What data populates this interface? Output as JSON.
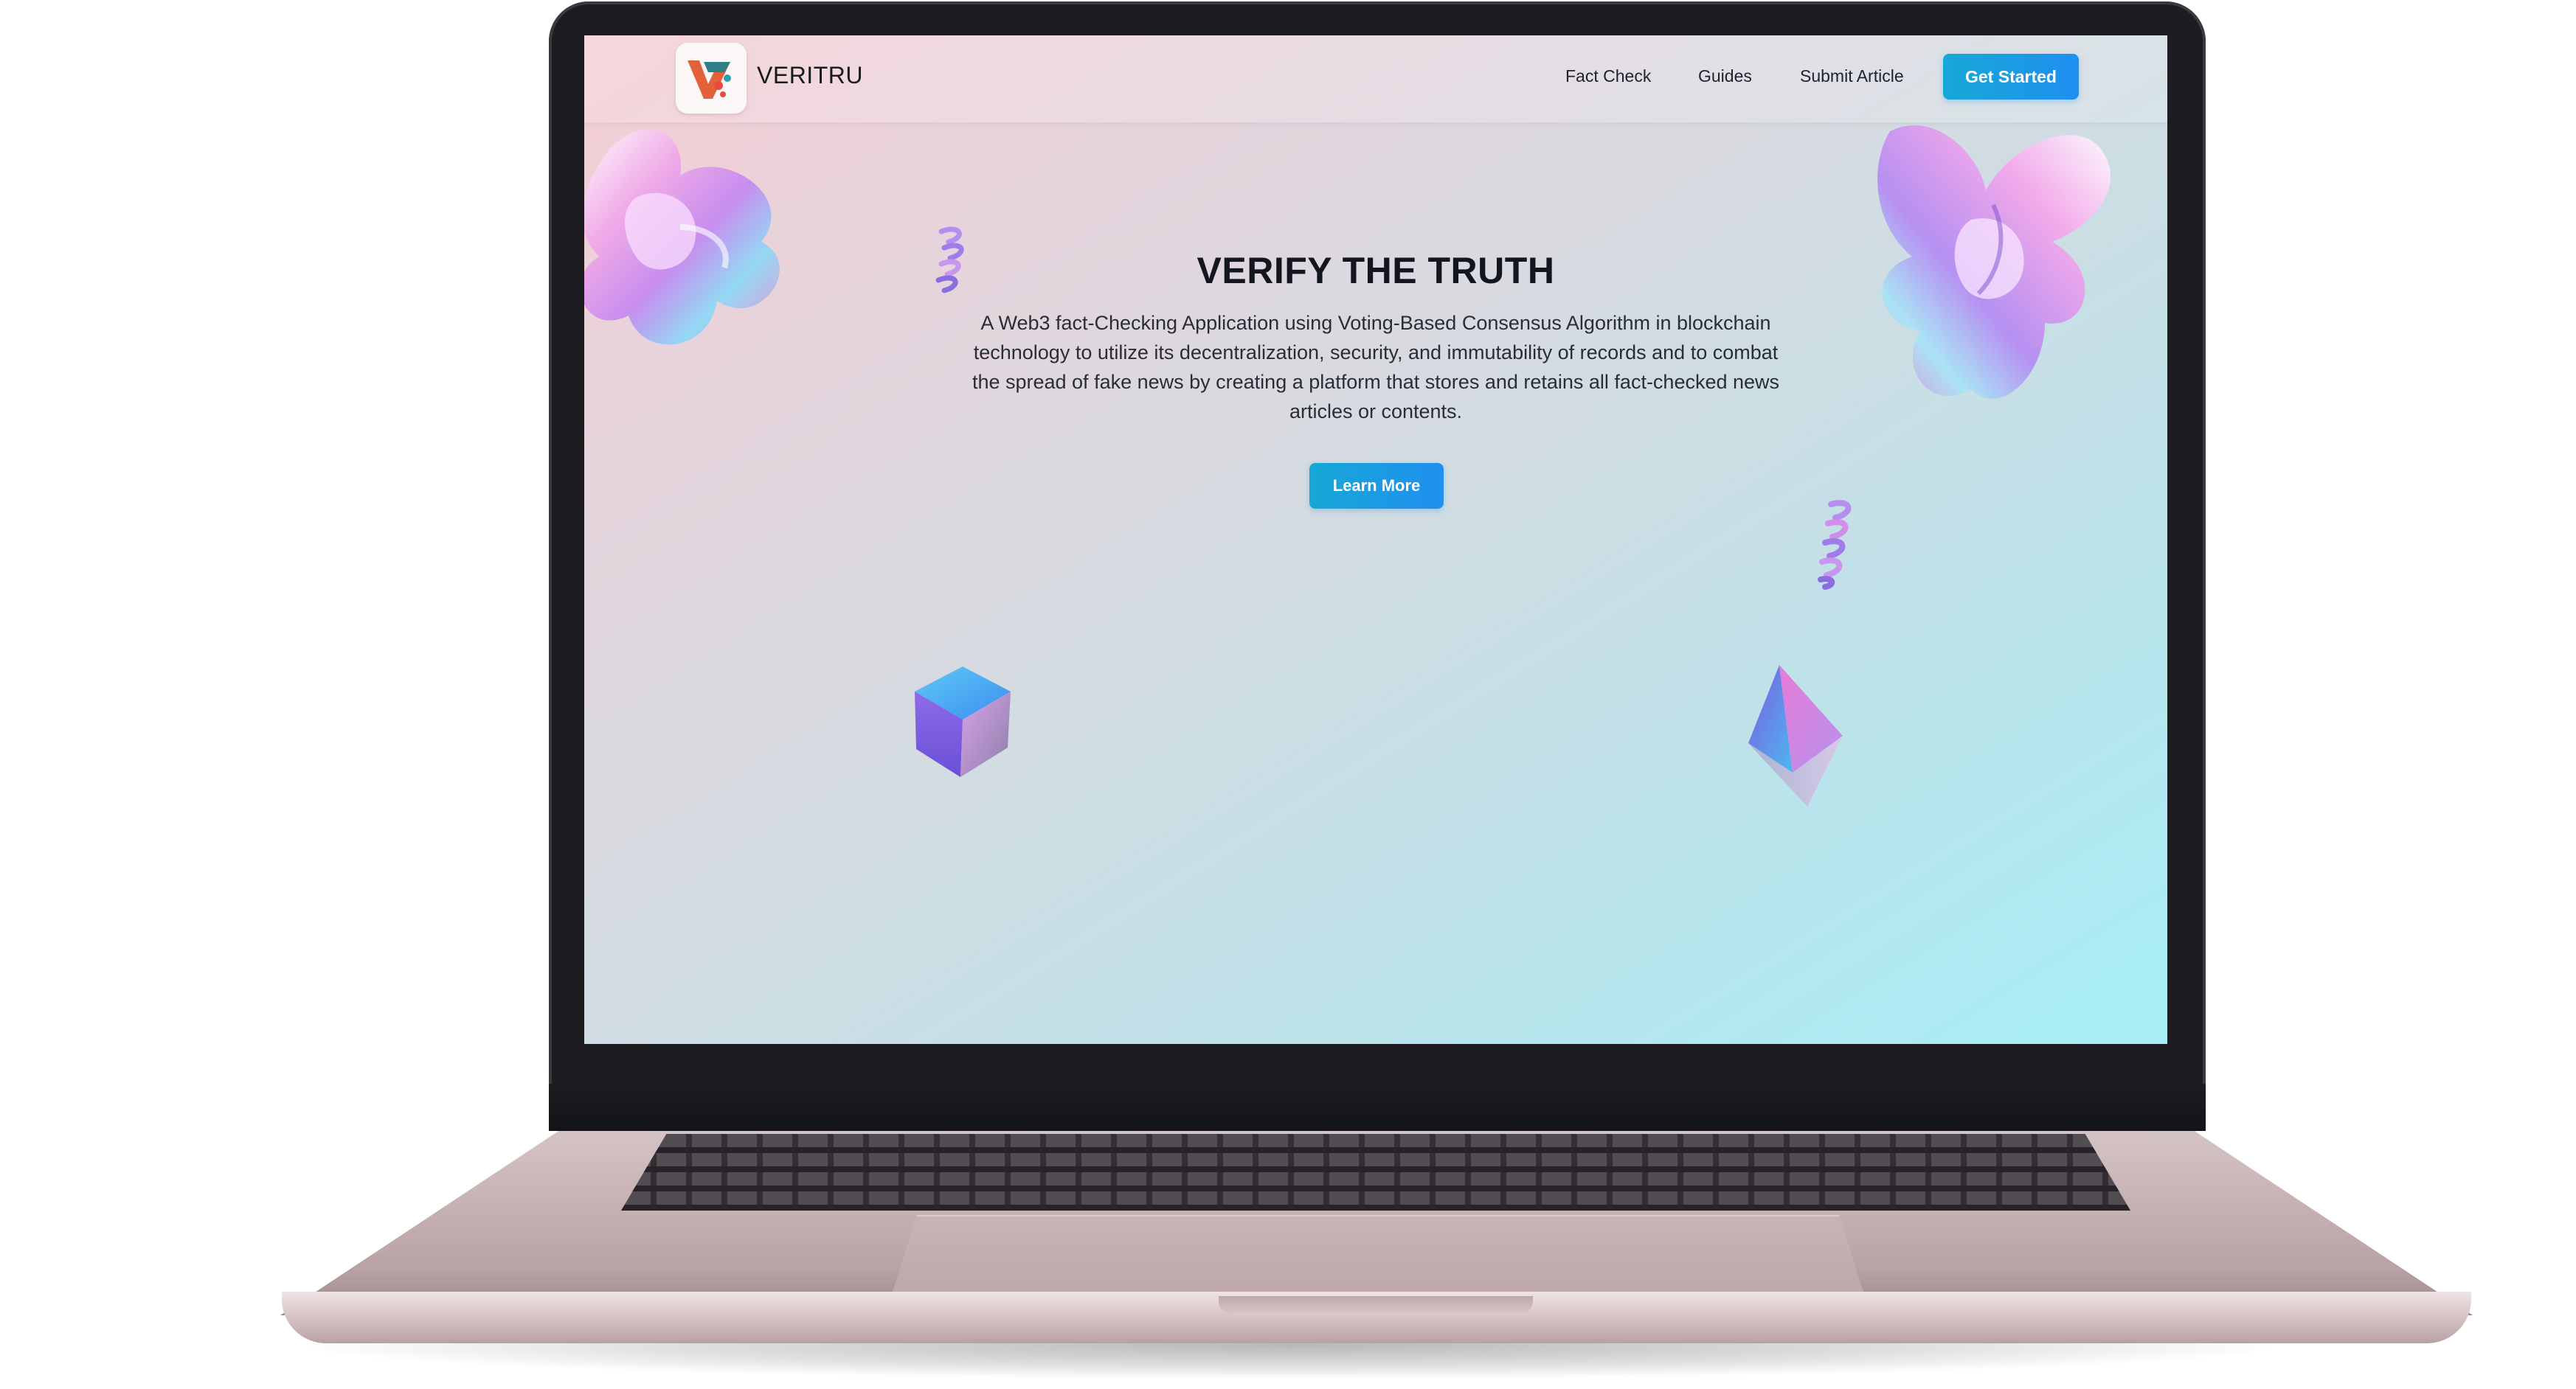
{
  "app": {
    "brand": "VERITRU",
    "accent_color": "#1f8ff0"
  },
  "nav": {
    "links": [
      "Fact Check",
      "Guides",
      "Submit Article"
    ],
    "cta_label": "Get Started"
  },
  "hero": {
    "title": "VERIFY THE TRUTH",
    "description": "A Web3 fact-Checking Application using Voting-Based Consensus Algorithm in blockchain technology to utilize its decentralization, security, and immutability of records and to combat the spread of fake news by creating a platform that stores and retains all fact-checked news articles or contents.",
    "button_label": "Learn More"
  },
  "decorations": {
    "icons": [
      "holographic-flower-icon",
      "spiral-icon",
      "cube-icon",
      "pyramid-icon"
    ]
  }
}
